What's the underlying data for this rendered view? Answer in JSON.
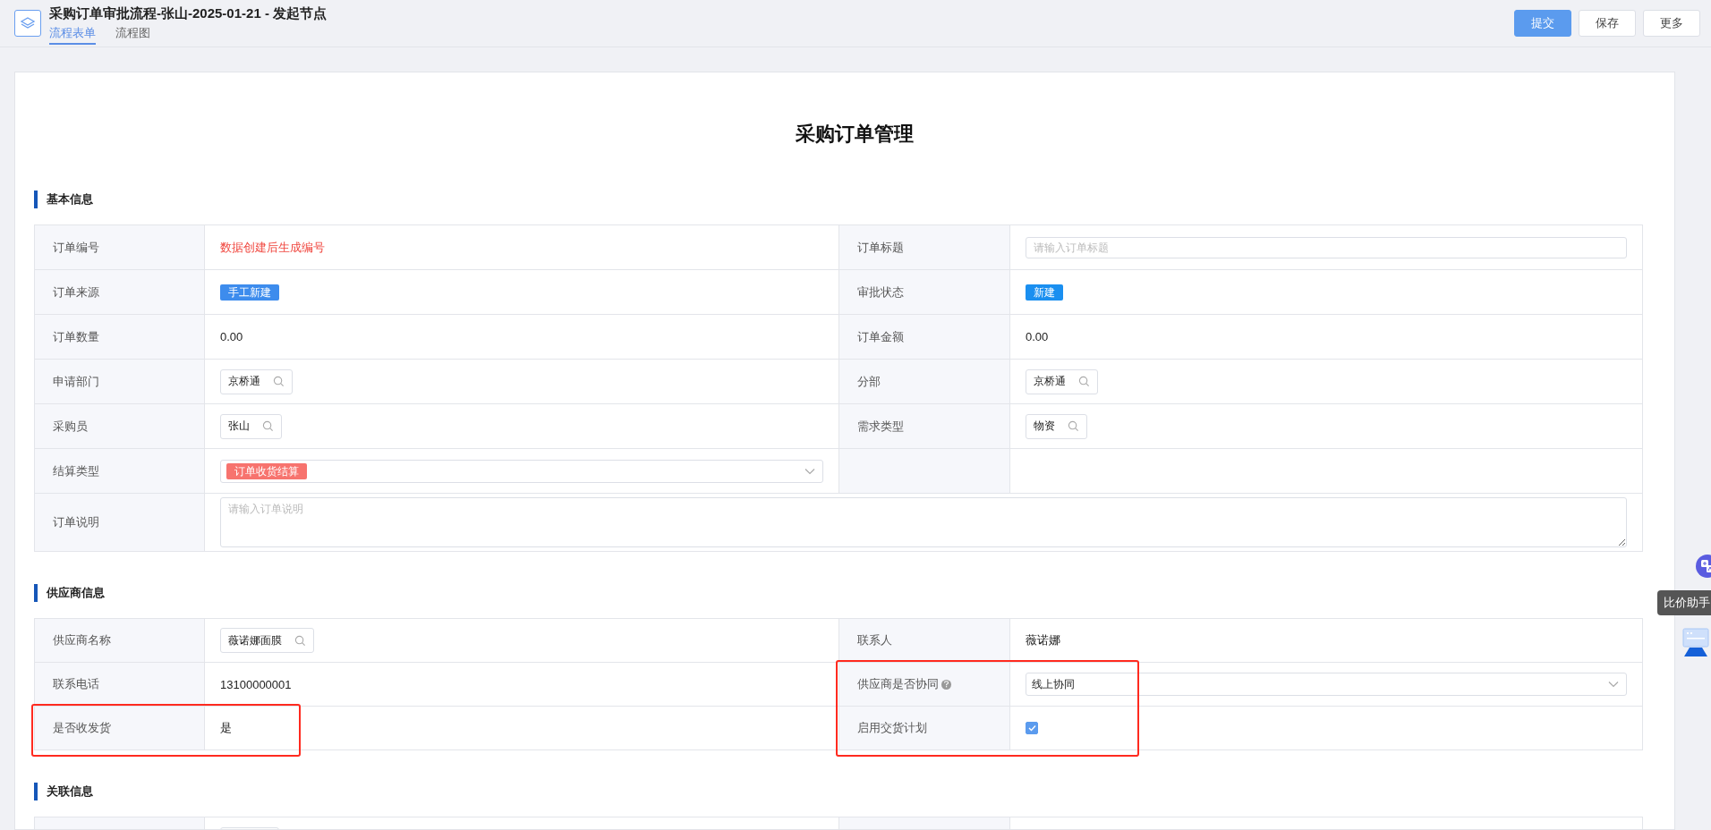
{
  "window": {
    "title": "采购订单审批流程-张山-2025-01-21 - 发起节点"
  },
  "tabs": [
    {
      "label": "流程表单",
      "selected": true
    },
    {
      "label": "流程图",
      "selected": false
    }
  ],
  "actions": [
    {
      "label": "提交",
      "kind": "primary"
    },
    {
      "label": "保存",
      "kind": "default"
    },
    {
      "label": "更多",
      "kind": "default"
    }
  ],
  "form_title": "采购订单管理",
  "sections": [
    {
      "title": "基本信息",
      "rows": [
        {
          "cells": [
            {
              "label": "订单编号",
              "value": {
                "kind": "notice",
                "text": "数据创建后生成编号"
              }
            },
            {
              "label": "订单标题",
              "value": {
                "kind": "input",
                "placeholder": "请输入订单标题"
              }
            }
          ]
        },
        {
          "cells": [
            {
              "label": "订单来源",
              "value": {
                "kind": "tag",
                "text": "手工新建",
                "color": "#3d8ced"
              }
            },
            {
              "label": "审批状态",
              "value": {
                "kind": "tag",
                "text": "新建",
                "color": "#1a8ff0"
              }
            }
          ]
        },
        {
          "cells": [
            {
              "label": "订单数量",
              "value": {
                "kind": "text",
                "text": "0.00"
              }
            },
            {
              "label": "订单金额",
              "value": {
                "kind": "text",
                "text": "0.00"
              }
            }
          ]
        },
        {
          "cells": [
            {
              "label": "申请部门",
              "value": {
                "kind": "lookup",
                "text": "京桥通"
              }
            },
            {
              "label": "分部",
              "value": {
                "kind": "lookup",
                "text": "京桥通"
              }
            }
          ]
        },
        {
          "cells": [
            {
              "label": "采购员",
              "value": {
                "kind": "lookup",
                "text": "张山"
              }
            },
            {
              "label": "需求类型",
              "value": {
                "kind": "lookup",
                "text": "物资"
              }
            }
          ]
        },
        {
          "cells": [
            {
              "label": "结算类型",
              "value": {
                "kind": "select_tag",
                "text": "订单收货结算",
                "color": "#f7736e"
              }
            },
            {
              "value": {
                "kind": "empty"
              }
            }
          ]
        },
        {
          "cells": [
            {
              "label": "订单说明",
              "value": {
                "kind": "textarea",
                "placeholder": "请输入订单说明"
              }
            }
          ]
        }
      ]
    },
    {
      "title": "供应商信息",
      "rows": [
        {
          "cells": [
            {
              "label": "供应商名称",
              "value": {
                "kind": "lookup",
                "text": "薇诺娜面膜"
              }
            },
            {
              "label": "联系人",
              "value": {
                "kind": "text",
                "text": "薇诺娜"
              }
            }
          ]
        },
        {
          "right_marked": true,
          "cells": [
            {
              "label": "联系电话",
              "value": {
                "kind": "text",
                "text": "13100000001"
              }
            },
            {
              "label": "供应商是否协同",
              "help": true,
              "value": {
                "kind": "select",
                "text": "线上协同"
              }
            }
          ]
        },
        {
          "left_marked": true,
          "right_marked": true,
          "cells": [
            {
              "label": "是否收发货",
              "value": {
                "kind": "text",
                "text": "是"
              }
            },
            {
              "label": "启用交货计划",
              "value": {
                "kind": "checkbox",
                "checked": true
              }
            }
          ]
        }
      ]
    },
    {
      "title": "关联信息",
      "rows": [
        {
          "cells": [
            {
              "value": {
                "kind": "lookup"
              }
            },
            {
              "value": {
                "kind": "empty"
              }
            }
          ]
        }
      ]
    }
  ],
  "assistant": {
    "tooltip": "比价助手"
  }
}
